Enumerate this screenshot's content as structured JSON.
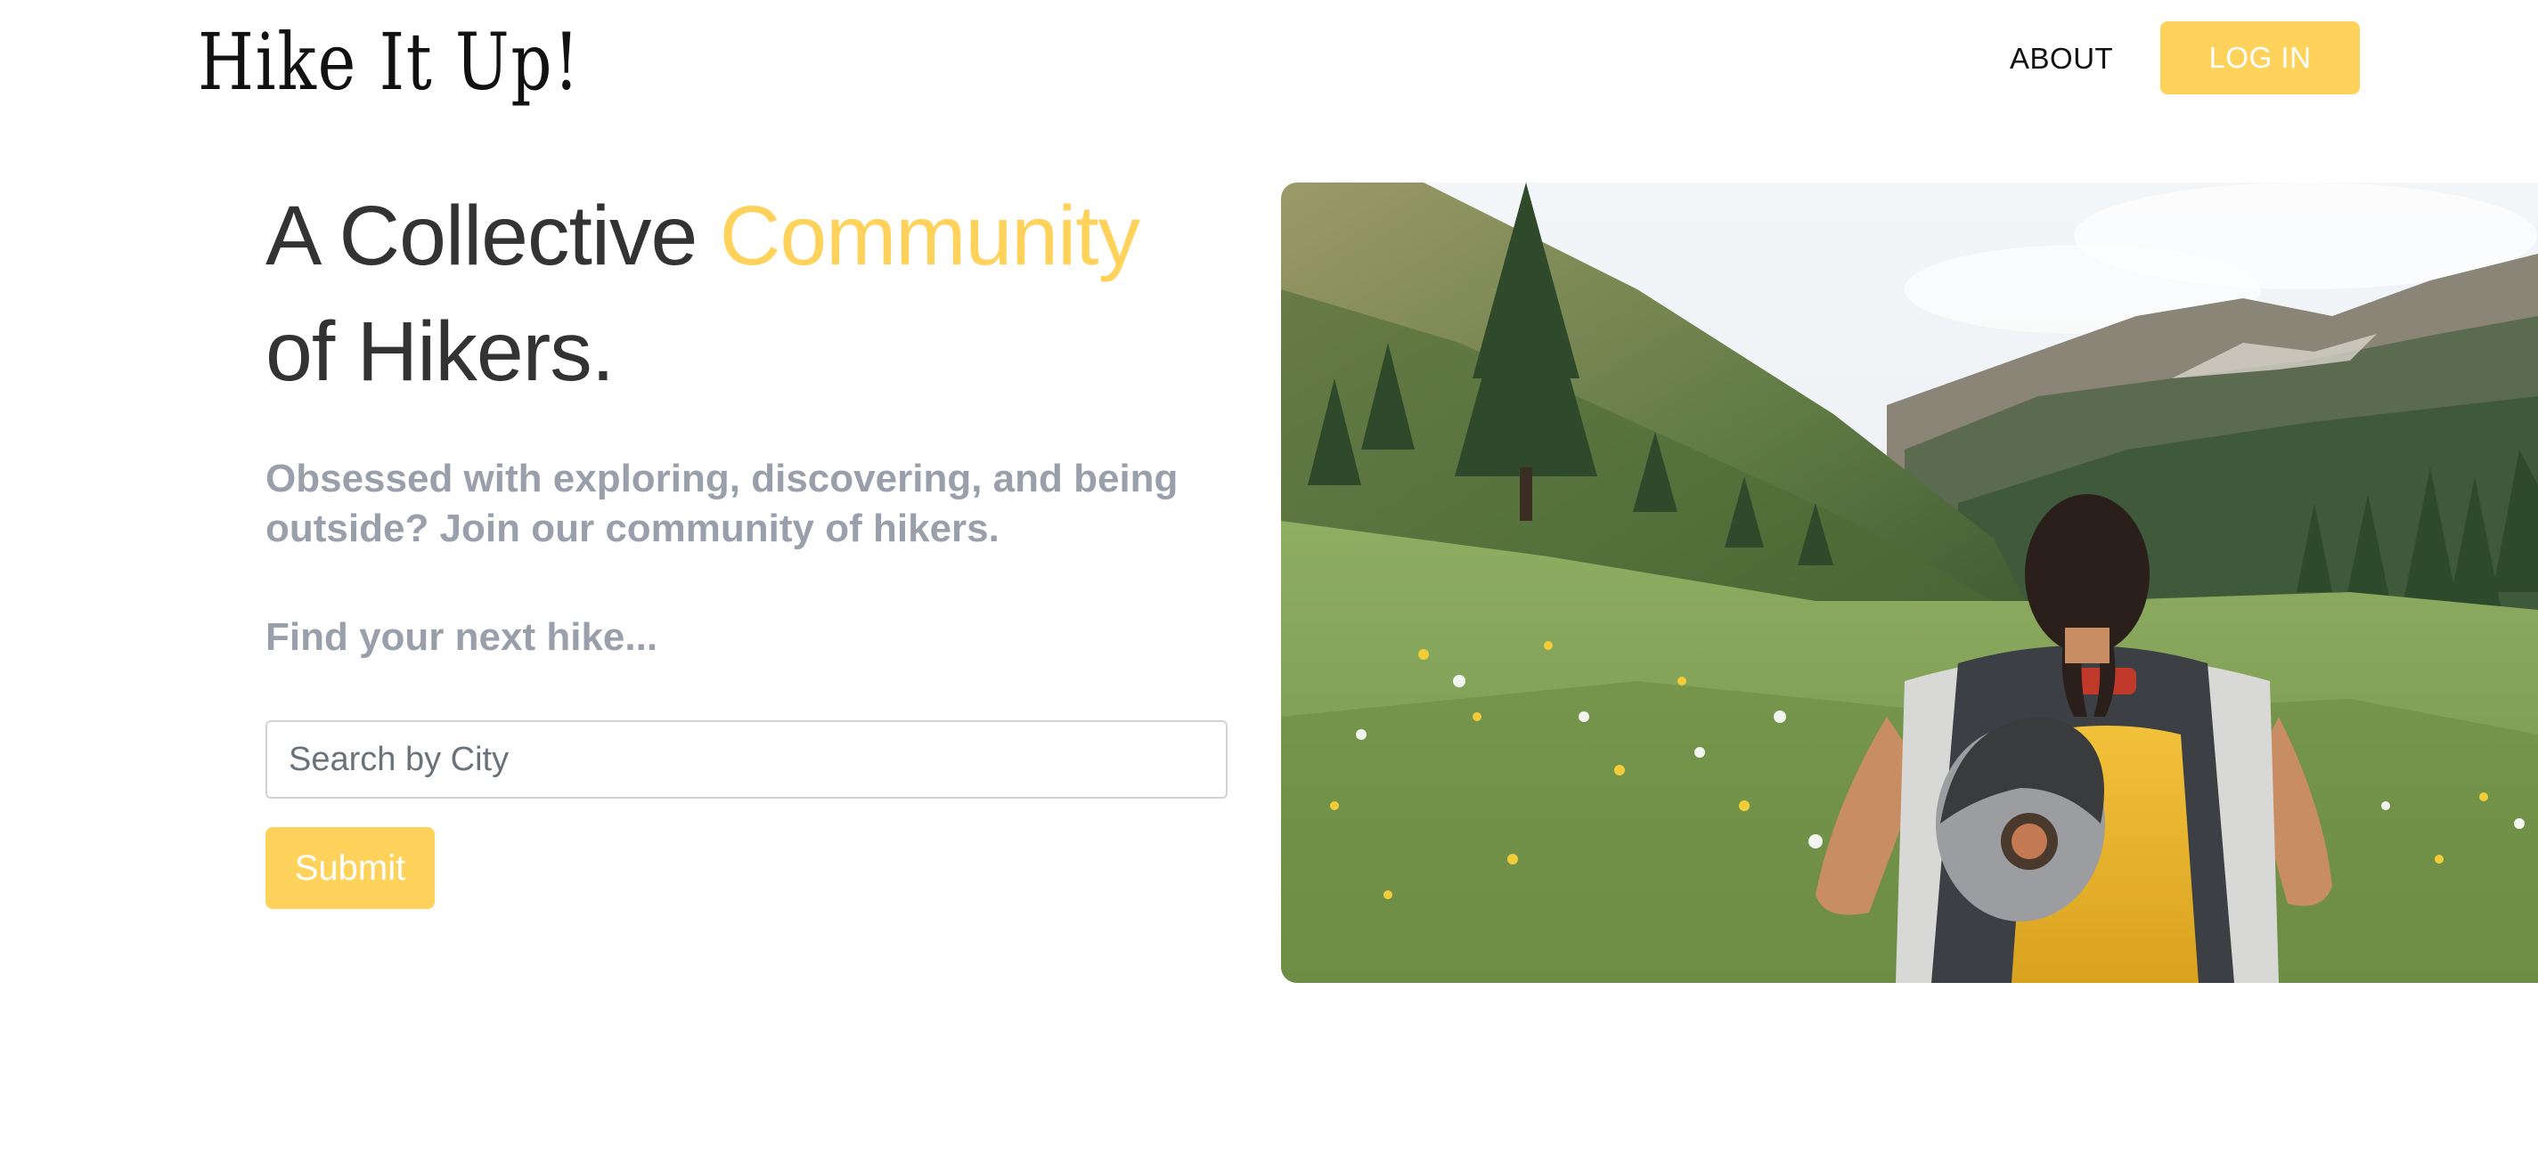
{
  "header": {
    "logo_text": "Hike It Up!",
    "nav": {
      "about_label": "ABOUT",
      "login_label": "LOG IN"
    }
  },
  "hero": {
    "title_part1": "A Collective ",
    "title_accent": "Community",
    "title_part2": "of Hikers.",
    "subtitle": "Obsessed with exploring, discovering, and being outside? Join our community of hikers.",
    "find_label": "Find your next hike...",
    "search": {
      "placeholder": "Search by City",
      "value": ""
    },
    "submit_label": "Submit",
    "image_subject": "hiker-with-yellow-backpack-in-mountain-meadow"
  },
  "colors": {
    "accent": "#ffd25c",
    "heading": "#333333",
    "muted": "#9aa0ab",
    "background": "#ffffff"
  }
}
